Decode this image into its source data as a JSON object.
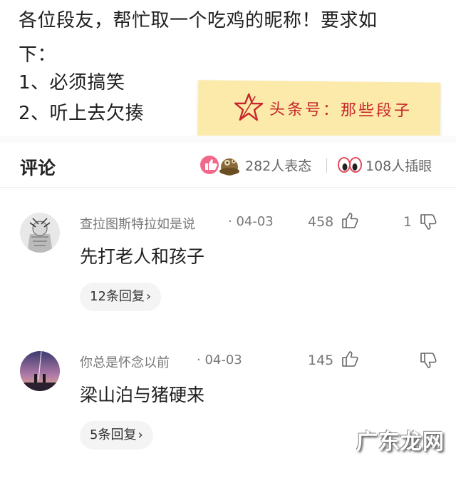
{
  "post": {
    "lines": [
      "各位段友，帮忙取一个吃鸡的昵称！要求如",
      "下：",
      "1、必须搞笑",
      "2、听上去欠揍"
    ],
    "sticky_text": "头条号：那些段子"
  },
  "comments_header": {
    "title": "评论",
    "reaction_count": "282人表态",
    "eye_count": "108人插眼"
  },
  "comments": [
    {
      "user": "查拉图斯特拉如是说",
      "date": "· 04-03",
      "likes": "458",
      "dislikes": "1",
      "text": "先打老人和孩子",
      "replies": "12条回复"
    },
    {
      "user": "你总是怀念以前",
      "date": "· 04-03",
      "likes": "145",
      "dislikes": "",
      "text": "梁山泊与猪硬来",
      "replies": "5条回复"
    }
  ],
  "watermark": "广东龙网",
  "icons": {
    "star": "star-icon",
    "like": "thumbs-up-icon",
    "dislike": "thumbs-down-icon",
    "reactions": "reaction-emoji-icons",
    "eyes": "eyes-icon",
    "chevron": "chevron-right-icon"
  },
  "colors": {
    "sticky_bg": "#fbeaaa",
    "sticky_text": "#c8262a",
    "reply_bg": "#f4f4f4"
  }
}
